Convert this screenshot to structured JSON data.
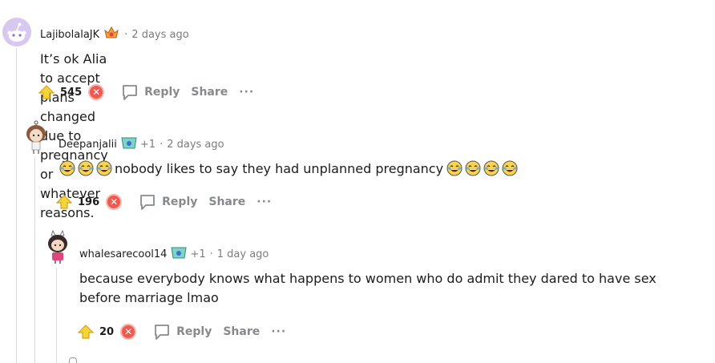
{
  "comments": [
    {
      "username": "LajibolalaJK",
      "timestamp": "2 days ago",
      "body": "It’s ok Alia to accept plans changed due to pregnancy or whatever reasons.",
      "score": "545",
      "reply_label": "Reply",
      "share_label": "Share",
      "more_label": "···"
    },
    {
      "username": "Deepanjalii",
      "flair_count": "+1",
      "timestamp": "2 days ago",
      "body_prefix_emojis": 3,
      "body": "nobody likes to say they had unplanned pregnancy",
      "body_suffix_emojis": 4,
      "score": "196",
      "reply_label": "Reply",
      "share_label": "Share",
      "more_label": "···"
    },
    {
      "username": "whalesarecool14",
      "flair_count": "+1",
      "timestamp": "1 day ago",
      "body_line1": "because everybody knows what happens to women who do admit they dared to have sex",
      "body_line2": "before marriage lmao",
      "score": "20",
      "reply_label": "Reply",
      "share_label": "Share",
      "more_label": "···"
    }
  ],
  "separator": "·",
  "colors": {
    "upvote": "#f5d33a",
    "downvote": "#ee5a4f",
    "action_text": "#878a8c",
    "meta_text": "#7c7c7c",
    "thread_line": "#dcdcdc"
  }
}
